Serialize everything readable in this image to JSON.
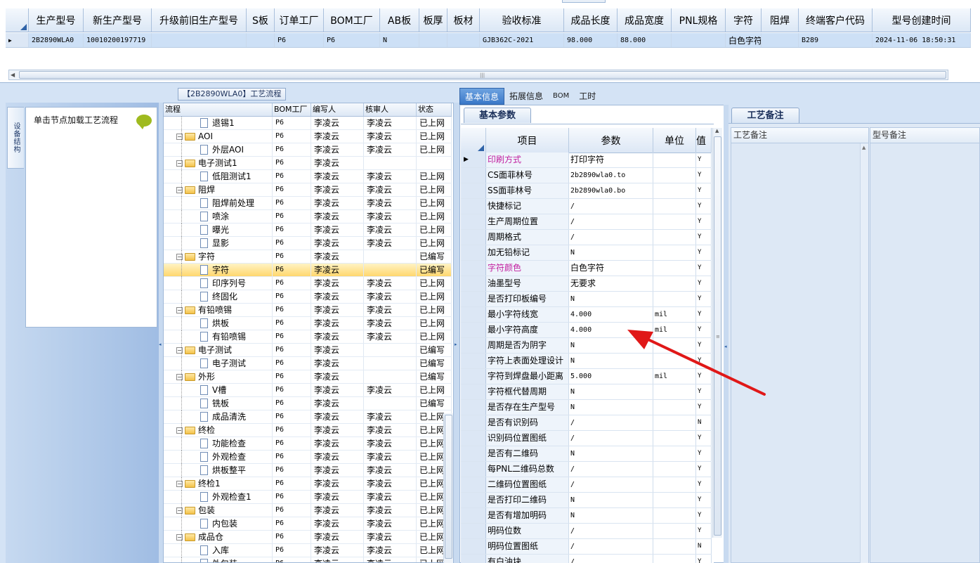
{
  "top_grid": {
    "headers": [
      "生产型号",
      "新生产型号",
      "升级前旧生产型号",
      "S板",
      "订单工厂",
      "BOM工厂",
      "AB板",
      "板厚",
      "板材",
      "验收标准",
      "成品长度",
      "成品宽度",
      "PNL规格",
      "字符",
      "阻焊",
      "终端客户代码",
      "型号创建时间"
    ],
    "row": [
      "2B2890WLA0",
      "10010200197719",
      "",
      "",
      "P6",
      "P6",
      "N",
      "",
      "",
      "GJB362C-2021",
      "98.000",
      "88.000",
      "",
      "白色字符",
      "",
      "B289",
      "2024-11-06 18:50:31"
    ],
    "row_indicator": "▶"
  },
  "left_panel": {
    "tab_label": "设备结构",
    "hint": "单击节点加载工艺流程"
  },
  "tree": {
    "title": "【2B2890WLA0】工艺流程",
    "headers": [
      "流程",
      "BOM工厂",
      "编写人",
      "核审人",
      "状态"
    ],
    "rows": [
      {
        "level": 1,
        "kind": "doc",
        "name": "退锡1",
        "bom": "P6",
        "writer": "李凌云",
        "checker": "李凌云",
        "status": "已上网"
      },
      {
        "level": 0,
        "kind": "folder",
        "name": "AOI",
        "bom": "P6",
        "writer": "李凌云",
        "checker": "李凌云",
        "status": "已上网"
      },
      {
        "level": 1,
        "kind": "doc",
        "name": "外层AOI",
        "bom": "P6",
        "writer": "李凌云",
        "checker": "李凌云",
        "status": "已上网"
      },
      {
        "level": 0,
        "kind": "folder",
        "name": "电子测试1",
        "bom": "P6",
        "writer": "李凌云",
        "checker": "",
        "status": ""
      },
      {
        "level": 1,
        "kind": "doc",
        "name": "低阻测试1",
        "bom": "P6",
        "writer": "李凌云",
        "checker": "李凌云",
        "status": "已上网"
      },
      {
        "level": 0,
        "kind": "folder",
        "name": "阻焊",
        "bom": "P6",
        "writer": "李凌云",
        "checker": "李凌云",
        "status": "已上网"
      },
      {
        "level": 1,
        "kind": "doc",
        "name": "阻焊前处理",
        "bom": "P6",
        "writer": "李凌云",
        "checker": "李凌云",
        "status": "已上网"
      },
      {
        "level": 1,
        "kind": "doc",
        "name": "喷涂",
        "bom": "P6",
        "writer": "李凌云",
        "checker": "李凌云",
        "status": "已上网"
      },
      {
        "level": 1,
        "kind": "doc",
        "name": "曝光",
        "bom": "P6",
        "writer": "李凌云",
        "checker": "李凌云",
        "status": "已上网"
      },
      {
        "level": 1,
        "kind": "doc",
        "name": "显影",
        "bom": "P6",
        "writer": "李凌云",
        "checker": "李凌云",
        "status": "已上网"
      },
      {
        "level": 0,
        "kind": "folder",
        "name": "字符",
        "bom": "P6",
        "writer": "李凌云",
        "checker": "",
        "status": "已编写"
      },
      {
        "level": 1,
        "kind": "doc",
        "name": "字符",
        "bom": "P6",
        "writer": "李凌云",
        "checker": "",
        "status": "已编写",
        "selected": true
      },
      {
        "level": 1,
        "kind": "doc",
        "name": "印序列号",
        "bom": "P6",
        "writer": "李凌云",
        "checker": "李凌云",
        "status": "已上网"
      },
      {
        "level": 1,
        "kind": "doc",
        "name": "终固化",
        "bom": "P6",
        "writer": "李凌云",
        "checker": "李凌云",
        "status": "已上网"
      },
      {
        "level": 0,
        "kind": "folder",
        "name": "有铅喷锡",
        "bom": "P6",
        "writer": "李凌云",
        "checker": "李凌云",
        "status": "已上网"
      },
      {
        "level": 1,
        "kind": "doc",
        "name": "烘板",
        "bom": "P6",
        "writer": "李凌云",
        "checker": "李凌云",
        "status": "已上网"
      },
      {
        "level": 1,
        "kind": "doc",
        "name": "有铅喷锡",
        "bom": "P6",
        "writer": "李凌云",
        "checker": "李凌云",
        "status": "已上网"
      },
      {
        "level": 0,
        "kind": "folder",
        "name": "电子测试",
        "bom": "P6",
        "writer": "李凌云",
        "checker": "",
        "status": "已编写"
      },
      {
        "level": 1,
        "kind": "doc",
        "name": "电子测试",
        "bom": "P6",
        "writer": "李凌云",
        "checker": "",
        "status": "已编写"
      },
      {
        "level": 0,
        "kind": "folder",
        "name": "外形",
        "bom": "P6",
        "writer": "李凌云",
        "checker": "",
        "status": "已编写"
      },
      {
        "level": 1,
        "kind": "doc",
        "name": "V槽",
        "bom": "P6",
        "writer": "李凌云",
        "checker": "李凌云",
        "status": "已上网"
      },
      {
        "level": 1,
        "kind": "doc",
        "name": "铣板",
        "bom": "P6",
        "writer": "李凌云",
        "checker": "",
        "status": "已编写"
      },
      {
        "level": 1,
        "kind": "doc",
        "name": "成品清洗",
        "bom": "P6",
        "writer": "李凌云",
        "checker": "李凌云",
        "status": "已上网"
      },
      {
        "level": 0,
        "kind": "folder",
        "name": "终检",
        "bom": "P6",
        "writer": "李凌云",
        "checker": "李凌云",
        "status": "已上网"
      },
      {
        "level": 1,
        "kind": "doc",
        "name": "功能检查",
        "bom": "P6",
        "writer": "李凌云",
        "checker": "李凌云",
        "status": "已上网"
      },
      {
        "level": 1,
        "kind": "doc",
        "name": "外观检查",
        "bom": "P6",
        "writer": "李凌云",
        "checker": "李凌云",
        "status": "已上网"
      },
      {
        "level": 1,
        "kind": "doc",
        "name": "烘板整平",
        "bom": "P6",
        "writer": "李凌云",
        "checker": "李凌云",
        "status": "已上网"
      },
      {
        "level": 0,
        "kind": "folder",
        "name": "终检1",
        "bom": "P6",
        "writer": "李凌云",
        "checker": "李凌云",
        "status": "已上网"
      },
      {
        "level": 1,
        "kind": "doc",
        "name": "外观检查1",
        "bom": "P6",
        "writer": "李凌云",
        "checker": "李凌云",
        "status": "已上网"
      },
      {
        "level": 0,
        "kind": "folder",
        "name": "包装",
        "bom": "P6",
        "writer": "李凌云",
        "checker": "李凌云",
        "status": "已上网"
      },
      {
        "level": 1,
        "kind": "doc",
        "name": "内包装",
        "bom": "P6",
        "writer": "李凌云",
        "checker": "李凌云",
        "status": "已上网"
      },
      {
        "level": 0,
        "kind": "folder",
        "name": "成品仓",
        "bom": "P6",
        "writer": "李凌云",
        "checker": "李凌云",
        "status": "已上网"
      },
      {
        "level": 1,
        "kind": "doc",
        "name": "入库",
        "bom": "P6",
        "writer": "李凌云",
        "checker": "李凌云",
        "status": "已上网"
      },
      {
        "level": 1,
        "kind": "doc",
        "name": "外包装",
        "bom": "P6",
        "writer": "李凌云",
        "checker": "李凌云",
        "status": "已上网"
      }
    ]
  },
  "mid": {
    "tabs": [
      "基本信息",
      "拓展信息",
      "BOM",
      "工时"
    ],
    "active_tab": 0,
    "sub_tab": "基本参数",
    "headers": [
      "项目",
      "参数",
      "单位",
      "值"
    ],
    "highlight_color": "#c21fa0",
    "rows": [
      {
        "item": "印刷方式",
        "param": "打印字符",
        "unit": "",
        "v": "Y",
        "hl": true,
        "cur": true
      },
      {
        "item": "CS面菲林号",
        "param": "2b2890wla0.to",
        "unit": "",
        "v": "Y"
      },
      {
        "item": "SS面菲林号",
        "param": "2b2890wla0.bo",
        "unit": "",
        "v": "Y"
      },
      {
        "item": "快捷标记",
        "param": "/",
        "unit": "",
        "v": "Y"
      },
      {
        "item": "生产周期位置",
        "param": "/",
        "unit": "",
        "v": "Y"
      },
      {
        "item": "周期格式",
        "param": "/",
        "unit": "",
        "v": "Y"
      },
      {
        "item": "加无铅标记",
        "param": "N",
        "unit": "",
        "v": "Y"
      },
      {
        "item": "字符颜色",
        "param": "白色字符",
        "unit": "",
        "v": "Y",
        "hl": true
      },
      {
        "item": "油墨型号",
        "param": "无要求",
        "unit": "",
        "v": "Y"
      },
      {
        "item": "是否打印板编号",
        "param": "N",
        "unit": "",
        "v": "Y"
      },
      {
        "item": "最小字符线宽",
        "param": "4.000",
        "unit": "mil",
        "v": "Y"
      },
      {
        "item": "最小字符高度",
        "param": "4.000",
        "unit": "mil",
        "v": "Y"
      },
      {
        "item": "周期是否为阴字",
        "param": "N",
        "unit": "",
        "v": "Y"
      },
      {
        "item": "字符上表面处理设计",
        "param": "N",
        "unit": "",
        "v": "Y"
      },
      {
        "item": "字符到焊盘最小距离",
        "param": "5.000",
        "unit": "mil",
        "v": "Y"
      },
      {
        "item": "字符框代替周期",
        "param": "N",
        "unit": "",
        "v": "Y"
      },
      {
        "item": "是否存在生产型号",
        "param": "N",
        "unit": "",
        "v": "Y"
      },
      {
        "item": "是否有识别码",
        "param": "/",
        "unit": "",
        "v": "N"
      },
      {
        "item": "识别码位置图纸",
        "param": "/",
        "unit": "",
        "v": "Y"
      },
      {
        "item": "是否有二维码",
        "param": "N",
        "unit": "",
        "v": "Y"
      },
      {
        "item": "每PNL二维码总数",
        "param": "/",
        "unit": "",
        "v": "Y"
      },
      {
        "item": "二维码位置图纸",
        "param": "/",
        "unit": "",
        "v": "Y"
      },
      {
        "item": "是否打印二维码",
        "param": "N",
        "unit": "",
        "v": "Y"
      },
      {
        "item": "是否有增加明码",
        "param": "N",
        "unit": "",
        "v": "Y"
      },
      {
        "item": "明码位数",
        "param": "/",
        "unit": "",
        "v": "Y"
      },
      {
        "item": "明码位置图纸",
        "param": "/",
        "unit": "",
        "v": "N"
      },
      {
        "item": "有白油块",
        "param": "/",
        "unit": "",
        "v": "Y"
      }
    ]
  },
  "right": {
    "tab": "工艺备注",
    "col1": "工艺备注",
    "col2": "型号备注"
  },
  "colors": {
    "arrow": "#e01818",
    "selection": "#ffd76e",
    "accent": "#3a78c8"
  }
}
